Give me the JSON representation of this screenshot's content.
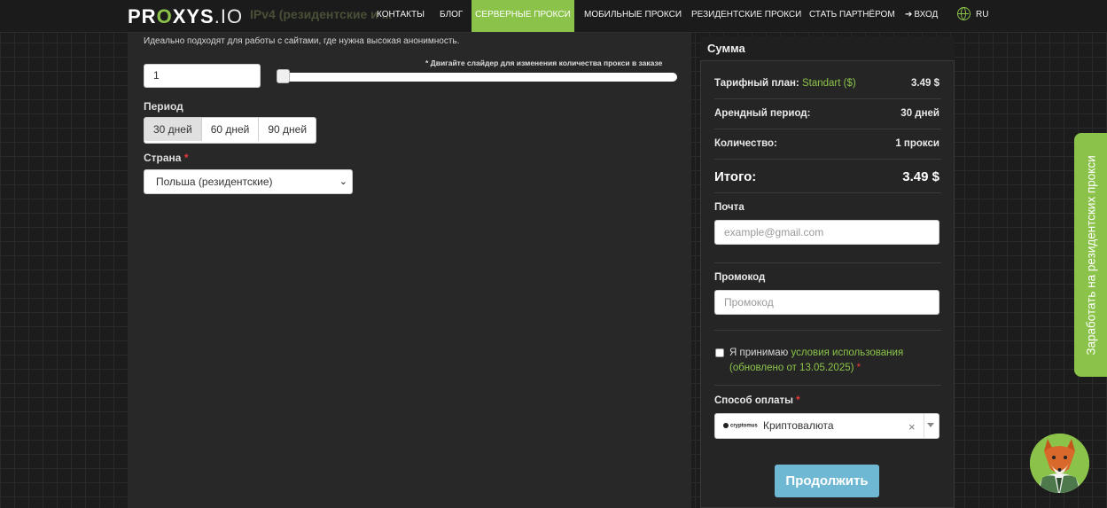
{
  "nav": {
    "logo_pre": "PR",
    "logo_leaf": "O",
    "logo_mid": "XYS",
    "logo_post": ".IO",
    "ghost_title": "IPv4 (резидентские и ...",
    "items": [
      {
        "label": "КОНТАКТЫ"
      },
      {
        "label": "БЛОГ"
      },
      {
        "label": "СЕРВЕРНЫЕ ПРОКСИ"
      },
      {
        "label": "МОБИЛЬНЫЕ ПРОКСИ"
      },
      {
        "label": "РЕЗИДЕНТСКИЕ ПРОКСИ"
      },
      {
        "label": "СТАТЬ ПАРТНЁРОМ"
      },
      {
        "label": "ВХОД"
      }
    ],
    "login_icon": "login-icon",
    "lang": "RU",
    "accent": "#8bc34a"
  },
  "form": {
    "hint": "Идеально подходят для работы с сайтами, где нужна высокая анонимность.",
    "quantity_value": "1",
    "slider_hint": "* Двигайте слайдер для изменения количества прокси в заказе",
    "slider_level": 0,
    "period_label": "Период",
    "periods": [
      {
        "label": "30 дней",
        "selected": true
      },
      {
        "label": "60 дней"
      },
      {
        "label": "90 дней"
      }
    ],
    "country_label": "Страна",
    "required_mark": "*",
    "country_value": "Польша (резидентские)"
  },
  "summary": {
    "title": "Сумма",
    "plan_label": "Тарифный план:",
    "plan_name": "Standart ($)",
    "plan_price": "3.49 $",
    "period_label": "Арендный период:",
    "period_value": "30 дней",
    "qty_label": "Количество:",
    "qty_value": "1 прокси",
    "total_label": "Итого:",
    "total_value": "3.49 $",
    "email_label": "Почта",
    "email_placeholder": "example@gmail.com",
    "promo_label": "Промокод",
    "promo_placeholder": "Промокод",
    "terms_pre": "Я принимаю",
    "terms_link": "условия использования",
    "terms_date": "(обновлено от 13.05.2025)",
    "payment_label": "Способ оплаты",
    "payment_logo": "cryptomus",
    "payment_value": "Криптовалюта",
    "clear_glyph": "×",
    "continue_label": "Продолжить",
    "continue_color": "#6fb8d3"
  },
  "side_tab": {
    "label": "Заработать на резидентских прокси"
  }
}
